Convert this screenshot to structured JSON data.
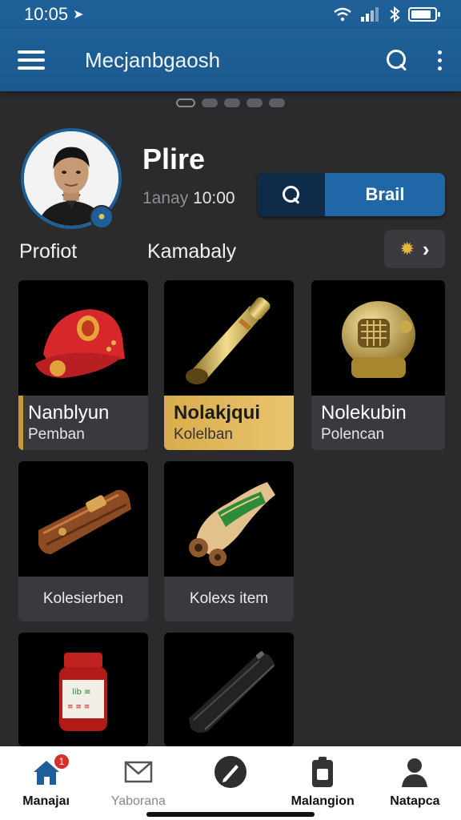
{
  "status": {
    "time": "10:05",
    "location_glyph": "➤"
  },
  "appbar": {
    "title": "Mecjanbgaosh"
  },
  "pager": {
    "count": 5,
    "active": 0
  },
  "profile": {
    "name": "Plire",
    "time_label": "1anay",
    "time_value": "10:00",
    "action_label": "Brail"
  },
  "filters": {
    "left": "Profiot",
    "middle": "Kamabaly"
  },
  "cards": [
    {
      "title": "Nanblyun",
      "subtitle": "Pemban",
      "icon": "cap-icon"
    },
    {
      "title": "Nolakjqui",
      "subtitle": "Kolelban",
      "icon": "horn-icon"
    },
    {
      "title": "Nolekubin",
      "subtitle": "Polencan",
      "icon": "diving-helmet-icon"
    },
    {
      "caption": "Kolesierben",
      "icon": "leather-wallet-icon"
    },
    {
      "caption": "Kolexs item",
      "icon": "scroll-icon"
    },
    {
      "caption": "",
      "icon": "jar-icon"
    },
    {
      "caption": "",
      "icon": "black-case-icon"
    }
  ],
  "nav": [
    {
      "label": "Manajaı",
      "icon": "home-icon",
      "badge": "1"
    },
    {
      "label": "Yaborana",
      "icon": "mail-icon"
    },
    {
      "label": "",
      "icon": "pen-icon"
    },
    {
      "label": "Malangion",
      "icon": "phone-icon"
    },
    {
      "label": "Natapca",
      "icon": "person-icon"
    }
  ],
  "colors": {
    "primary": "#1d5f96",
    "background": "#2b2b2e",
    "gold": "#e0b85a"
  }
}
